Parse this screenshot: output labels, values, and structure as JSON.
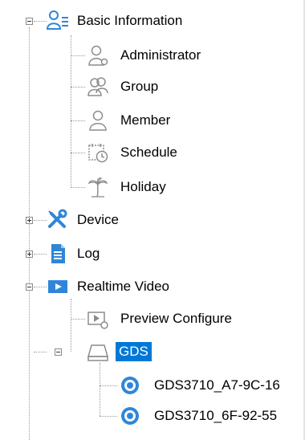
{
  "tree": {
    "basic_information": {
      "label": "Basic Information",
      "icon": "users-list-icon",
      "expanded": true
    },
    "administrator": {
      "label": "Administrator",
      "icon": "admin-user-icon"
    },
    "group": {
      "label": "Group",
      "icon": "group-icon"
    },
    "member": {
      "label": "Member",
      "icon": "member-icon"
    },
    "schedule": {
      "label": "Schedule",
      "icon": "calendar-clock-icon"
    },
    "holiday": {
      "label": "Holiday",
      "icon": "palm-tree-icon"
    },
    "device": {
      "label": "Device",
      "icon": "tools-icon",
      "expanded": false
    },
    "log": {
      "label": "Log",
      "icon": "document-icon",
      "expanded": false
    },
    "realtime_video": {
      "label": "Realtime Video",
      "icon": "play-icon",
      "expanded": true
    },
    "preview_configure": {
      "label": "Preview Configure",
      "icon": "video-settings-icon"
    },
    "gds": {
      "label": "GDS",
      "icon": "device-tray-icon",
      "expanded": true,
      "selected": true
    },
    "camera1": {
      "label": "GDS3710_A7-9C-16",
      "icon": "camera-icon"
    },
    "camera2": {
      "label": "GDS3710_6F-92-55",
      "icon": "camera-icon"
    }
  },
  "colors": {
    "accent": "#0078d7",
    "icon_blue": "#2f86d8",
    "icon_gray": "#8c8c8c"
  }
}
